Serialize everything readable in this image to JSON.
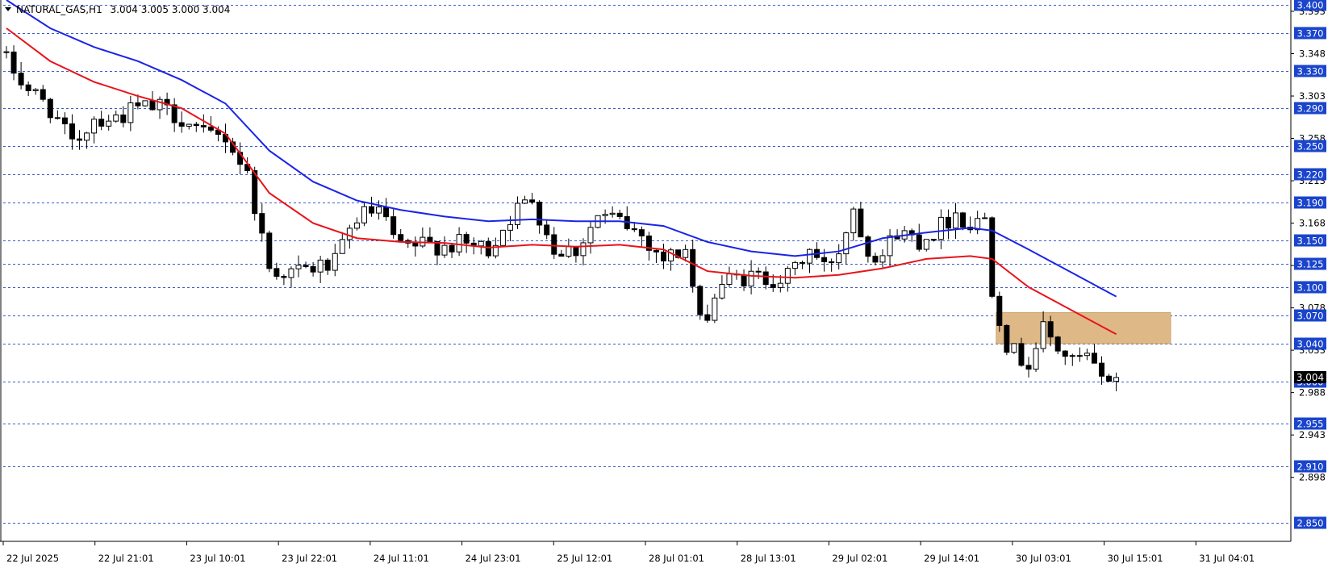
{
  "header": {
    "symbol": "NATURAL_GAS,H1",
    "ohlc": "3.004 3.005 3.000 3.004"
  },
  "colors": {
    "grid": "#3a5bcc",
    "candle": "#000000",
    "ma_fast": "#e8141a",
    "ma_slow": "#1a24e6",
    "zone": "#deb887",
    "label_bg": "#1a44cc"
  },
  "chart_data": {
    "type": "candlestick",
    "ylim": [
      2.83,
      3.405
    ],
    "axis_ticks": [
      "3.393",
      "3.348",
      "3.303",
      "3.258",
      "3.213",
      "3.168",
      "3.123",
      "3.078",
      "3.033",
      "2.988",
      "2.943",
      "2.898"
    ],
    "level_lines": [
      "3.400",
      "3.370",
      "3.330",
      "3.290",
      "3.250",
      "3.220",
      "3.190",
      "3.150",
      "3.125",
      "3.100",
      "3.070",
      "3.040",
      "3.000",
      "2.955",
      "2.910",
      "2.850"
    ],
    "current_price_label": "3.004",
    "x_labels": [
      "22 Jul 2025",
      "22 Jul 21:01",
      "23 Jul 10:01",
      "23 Jul 22:01",
      "24 Jul 11:01",
      "24 Jul 23:01",
      "25 Jul 12:01",
      "28 Jul 01:01",
      "28 Jul 13:01",
      "29 Jul 02:01",
      "29 Jul 14:01",
      "30 Jul 03:01",
      "30 Jul 15:01",
      "31 Jul 04:01"
    ],
    "zone": {
      "from_bar": 136,
      "to_bar": 159,
      "low": 3.04,
      "high": 3.073
    },
    "anchors": [
      [
        0,
        3.34
      ],
      [
        3,
        3.31
      ],
      [
        6,
        3.29
      ],
      [
        9,
        3.25
      ],
      [
        12,
        3.28
      ],
      [
        15,
        3.28
      ],
      [
        18,
        3.29
      ],
      [
        21,
        3.29
      ],
      [
        24,
        3.28
      ],
      [
        27,
        3.26
      ],
      [
        30,
        3.26
      ],
      [
        33,
        3.22
      ],
      [
        36,
        3.12
      ],
      [
        39,
        3.115
      ],
      [
        42,
        3.12
      ],
      [
        45,
        3.125
      ],
      [
        48,
        3.175
      ],
      [
        51,
        3.18
      ],
      [
        54,
        3.14
      ],
      [
        57,
        3.145
      ],
      [
        60,
        3.145
      ],
      [
        63,
        3.145
      ],
      [
        66,
        3.14
      ],
      [
        69,
        3.175
      ],
      [
        72,
        3.195
      ],
      [
        75,
        3.14
      ],
      [
        78,
        3.14
      ],
      [
        81,
        3.175
      ],
      [
        84,
        3.17
      ],
      [
        87,
        3.155
      ],
      [
        90,
        3.13
      ],
      [
        93,
        3.14
      ],
      [
        95,
        3.06
      ],
      [
        98,
        3.105
      ],
      [
        101,
        3.11
      ],
      [
        104,
        3.11
      ],
      [
        107,
        3.11
      ],
      [
        110,
        3.14
      ],
      [
        112,
        3.12
      ],
      [
        114,
        3.14
      ],
      [
        116,
        3.185
      ],
      [
        118,
        3.14
      ],
      [
        120,
        3.135
      ],
      [
        122,
        3.16
      ],
      [
        125,
        3.15
      ],
      [
        128,
        3.165
      ],
      [
        130,
        3.18
      ],
      [
        132,
        3.165
      ],
      [
        134,
        3.175
      ],
      [
        135,
        3.1
      ],
      [
        137,
        3.04
      ],
      [
        138,
        3.03
      ],
      [
        140,
        3.02
      ],
      [
        142,
        3.055
      ],
      [
        144,
        3.035
      ],
      [
        146,
        3.02
      ],
      [
        148,
        3.025
      ],
      [
        150,
        3.0
      ],
      [
        151,
        3.005
      ],
      [
        152,
        3.004
      ]
    ],
    "ma_fast_points": [
      [
        0,
        3.375
      ],
      [
        6,
        3.34
      ],
      [
        12,
        3.318
      ],
      [
        18,
        3.303
      ],
      [
        24,
        3.29
      ],
      [
        30,
        3.263
      ],
      [
        36,
        3.2
      ],
      [
        42,
        3.168
      ],
      [
        48,
        3.152
      ],
      [
        54,
        3.148
      ],
      [
        60,
        3.147
      ],
      [
        66,
        3.142
      ],
      [
        72,
        3.145
      ],
      [
        78,
        3.143
      ],
      [
        84,
        3.145
      ],
      [
        90,
        3.14
      ],
      [
        96,
        3.117
      ],
      [
        102,
        3.112
      ],
      [
        108,
        3.11
      ],
      [
        114,
        3.113
      ],
      [
        120,
        3.12
      ],
      [
        126,
        3.13
      ],
      [
        132,
        3.133
      ],
      [
        135,
        3.13
      ],
      [
        140,
        3.1
      ],
      [
        146,
        3.075
      ],
      [
        152,
        3.05
      ]
    ],
    "ma_slow_points": [
      [
        0,
        3.405
      ],
      [
        6,
        3.375
      ],
      [
        12,
        3.355
      ],
      [
        18,
        3.34
      ],
      [
        24,
        3.32
      ],
      [
        30,
        3.295
      ],
      [
        36,
        3.245
      ],
      [
        42,
        3.212
      ],
      [
        48,
        3.192
      ],
      [
        54,
        3.182
      ],
      [
        60,
        3.175
      ],
      [
        66,
        3.17
      ],
      [
        72,
        3.172
      ],
      [
        78,
        3.17
      ],
      [
        84,
        3.17
      ],
      [
        90,
        3.165
      ],
      [
        96,
        3.148
      ],
      [
        102,
        3.138
      ],
      [
        108,
        3.133
      ],
      [
        114,
        3.138
      ],
      [
        120,
        3.152
      ],
      [
        126,
        3.158
      ],
      [
        132,
        3.163
      ],
      [
        135,
        3.16
      ],
      [
        140,
        3.14
      ],
      [
        146,
        3.115
      ],
      [
        152,
        3.09
      ]
    ]
  }
}
